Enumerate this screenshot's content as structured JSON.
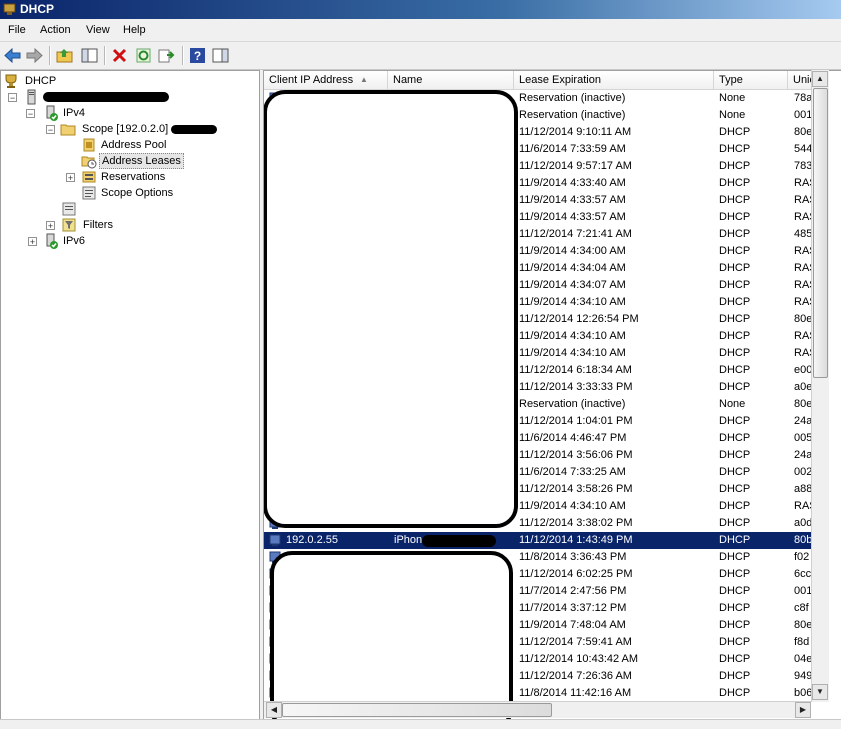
{
  "window": {
    "title": "DHCP"
  },
  "menu": [
    "File",
    "Action",
    "View",
    "Help"
  ],
  "toolbar": [
    "back-icon",
    "forward-icon",
    "up-folder-icon",
    "show-hide-tree-icon",
    "delete-icon",
    "refresh-icon",
    "export-list-icon",
    "help-icon",
    "action-pane-icon"
  ],
  "tree": {
    "root": "DHCP",
    "ipv4": "IPv4",
    "scope": "Scope [192.0.2.0]",
    "address_pool": "Address Pool",
    "address_leases": "Address Leases",
    "reservations": "Reservations",
    "scope_options": "Scope Options",
    "filters": "Filters",
    "ipv6": "IPv6"
  },
  "columns": {
    "client_ip": "Client IP Address",
    "name": "Name",
    "lease_expiration": "Lease Expiration",
    "type": "Type",
    "unique_id": "Unic"
  },
  "rows": [
    {
      "ip": "",
      "name": "",
      "lease": "Reservation (inactive)",
      "type": "None",
      "uid": "78a"
    },
    {
      "ip": "",
      "name": "",
      "lease": "Reservation (inactive)",
      "type": "None",
      "uid": "001"
    },
    {
      "ip": "",
      "name": "",
      "lease": "11/12/2014 9:10:11 AM",
      "type": "DHCP",
      "uid": "80e"
    },
    {
      "ip": "",
      "name": "",
      "lease": "11/6/2014 7:33:59 AM",
      "type": "DHCP",
      "uid": "544"
    },
    {
      "ip": "",
      "name": "",
      "lease": "11/12/2014 9:57:17 AM",
      "type": "DHCP",
      "uid": "783"
    },
    {
      "ip": "",
      "name": "",
      "lease": "11/9/2014 4:33:40 AM",
      "type": "DHCP",
      "uid": "RAS"
    },
    {
      "ip": "",
      "name": "",
      "lease": "11/9/2014 4:33:57 AM",
      "type": "DHCP",
      "uid": "RAS"
    },
    {
      "ip": "",
      "name": "",
      "lease": "11/9/2014 4:33:57 AM",
      "type": "DHCP",
      "uid": "RAS"
    },
    {
      "ip": "",
      "name": "",
      "lease": "11/12/2014 7:21:41 AM",
      "type": "DHCP",
      "uid": "485"
    },
    {
      "ip": "",
      "name": "",
      "lease": "11/9/2014 4:34:00 AM",
      "type": "DHCP",
      "uid": "RAS"
    },
    {
      "ip": "",
      "name": "",
      "lease": "11/9/2014 4:34:04 AM",
      "type": "DHCP",
      "uid": "RAS"
    },
    {
      "ip": "",
      "name": "",
      "lease": "11/9/2014 4:34:07 AM",
      "type": "DHCP",
      "uid": "RAS"
    },
    {
      "ip": "",
      "name": "",
      "lease": "11/9/2014 4:34:10 AM",
      "type": "DHCP",
      "uid": "RAS"
    },
    {
      "ip": "",
      "name": "",
      "lease": "11/12/2014 12:26:54 PM",
      "type": "DHCP",
      "uid": "80e"
    },
    {
      "ip": "",
      "name": "",
      "lease": "11/9/2014 4:34:10 AM",
      "type": "DHCP",
      "uid": "RAS"
    },
    {
      "ip": "",
      "name": "",
      "lease": "11/9/2014 4:34:10 AM",
      "type": "DHCP",
      "uid": "RAS"
    },
    {
      "ip": "",
      "name": "",
      "lease": "11/12/2014 6:18:34 AM",
      "type": "DHCP",
      "uid": "e00"
    },
    {
      "ip": "",
      "name": "",
      "lease": "11/12/2014 3:33:33 PM",
      "type": "DHCP",
      "uid": "a0e"
    },
    {
      "ip": "",
      "name": "",
      "lease": "Reservation (inactive)",
      "type": "None",
      "uid": "80e"
    },
    {
      "ip": "",
      "name": "",
      "lease": "11/12/2014 1:04:01 PM",
      "type": "DHCP",
      "uid": "24a"
    },
    {
      "ip": "",
      "name": "",
      "lease": "11/6/2014 4:46:47 PM",
      "type": "DHCP",
      "uid": "005"
    },
    {
      "ip": "",
      "name": "",
      "lease": "11/12/2014 3:56:06 PM",
      "type": "DHCP",
      "uid": "24a"
    },
    {
      "ip": "",
      "name": "",
      "lease": "11/6/2014 7:33:25 AM",
      "type": "DHCP",
      "uid": "002"
    },
    {
      "ip": "",
      "name": "",
      "lease": "11/12/2014 3:58:26 PM",
      "type": "DHCP",
      "uid": "a88"
    },
    {
      "ip": "",
      "name": "",
      "lease": "11/9/2014 4:34:10 AM",
      "type": "DHCP",
      "uid": "RAS"
    },
    {
      "ip": "",
      "name": "",
      "lease": "11/12/2014 3:38:02 PM",
      "type": "DHCP",
      "uid": "a0d"
    },
    {
      "ip": "192.0.2.55",
      "name": "iPhone.",
      "lease": "11/12/2014 1:43:49 PM",
      "type": "DHCP",
      "uid": "80b",
      "selected": true
    },
    {
      "ip": "",
      "name": "",
      "lease": "11/8/2014 3:36:43 PM",
      "type": "DHCP",
      "uid": "f02"
    },
    {
      "ip": "",
      "name": "",
      "lease": "11/12/2014 6:02:25 PM",
      "type": "DHCP",
      "uid": "6cc"
    },
    {
      "ip": "",
      "name": "",
      "lease": "11/7/2014 2:47:56 PM",
      "type": "DHCP",
      "uid": "001"
    },
    {
      "ip": "",
      "name": "",
      "lease": "11/7/2014 3:37:12 PM",
      "type": "DHCP",
      "uid": "c8f"
    },
    {
      "ip": "",
      "name": "",
      "lease": "11/9/2014 7:48:04 AM",
      "type": "DHCP",
      "uid": "80e"
    },
    {
      "ip": "",
      "name": "",
      "lease": "11/12/2014 7:59:41 AM",
      "type": "DHCP",
      "uid": "f8d"
    },
    {
      "ip": "",
      "name": "",
      "lease": "11/12/2014 10:43:42 AM",
      "type": "DHCP",
      "uid": "04e"
    },
    {
      "ip": "",
      "name": "",
      "lease": "11/12/2014 7:26:36 AM",
      "type": "DHCP",
      "uid": "949"
    },
    {
      "ip": "",
      "name": "",
      "lease": "11/8/2014 11:42:16 AM",
      "type": "DHCP",
      "uid": "b06"
    }
  ],
  "colors": {
    "selection": "#0a246a",
    "title_bar": "#0a246a"
  },
  "scrollbars": {
    "vertical": "scrollbar",
    "horizontal": "scrollbar"
  }
}
